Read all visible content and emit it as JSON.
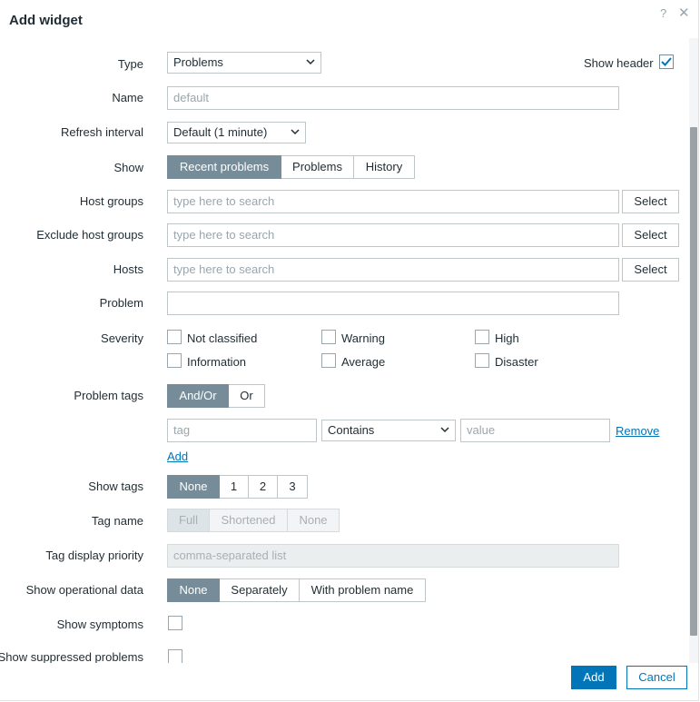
{
  "dialog": {
    "title": "Add widget",
    "help_icon": "?",
    "close_icon": "✕"
  },
  "form": {
    "type": {
      "label": "Type",
      "value": "Problems"
    },
    "show_header": {
      "label": "Show header",
      "checked": true
    },
    "name": {
      "label": "Name",
      "placeholder": "default"
    },
    "refresh_interval": {
      "label": "Refresh interval",
      "value": "Default (1 minute)"
    },
    "show": {
      "label": "Show",
      "options": [
        "Recent problems",
        "Problems",
        "History"
      ],
      "selected": "Recent problems"
    },
    "host_groups": {
      "label": "Host groups",
      "placeholder": "type here to search",
      "button": "Select"
    },
    "exclude_host_groups": {
      "label": "Exclude host groups",
      "placeholder": "type here to search",
      "button": "Select"
    },
    "hosts": {
      "label": "Hosts",
      "placeholder": "type here to search",
      "button": "Select"
    },
    "problem": {
      "label": "Problem",
      "value": ""
    },
    "severity": {
      "label": "Severity",
      "options": [
        "Not classified",
        "Warning",
        "High",
        "Information",
        "Average",
        "Disaster"
      ]
    },
    "problem_tags": {
      "label": "Problem tags",
      "options": [
        "And/Or",
        "Or"
      ],
      "selected": "And/Or",
      "tag_placeholder": "tag",
      "operator": "Contains",
      "value_placeholder": "value",
      "remove": "Remove",
      "add": "Add"
    },
    "show_tags": {
      "label": "Show tags",
      "options": [
        "None",
        "1",
        "2",
        "3"
      ],
      "selected": "None"
    },
    "tag_name": {
      "label": "Tag name",
      "options": [
        "Full",
        "Shortened",
        "None"
      ],
      "selected": "Full"
    },
    "tag_display_priority": {
      "label": "Tag display priority",
      "placeholder": "comma-separated list"
    },
    "show_operational_data": {
      "label": "Show operational data",
      "options": [
        "None",
        "Separately",
        "With problem name"
      ],
      "selected": "None"
    },
    "show_symptoms": {
      "label": "Show symptoms"
    },
    "show_suppressed": {
      "label": "Show suppressed problems"
    }
  },
  "footer": {
    "add": "Add",
    "cancel": "Cancel"
  },
  "colors": {
    "accent": "#0275b8",
    "segment_on": "#768d99"
  }
}
